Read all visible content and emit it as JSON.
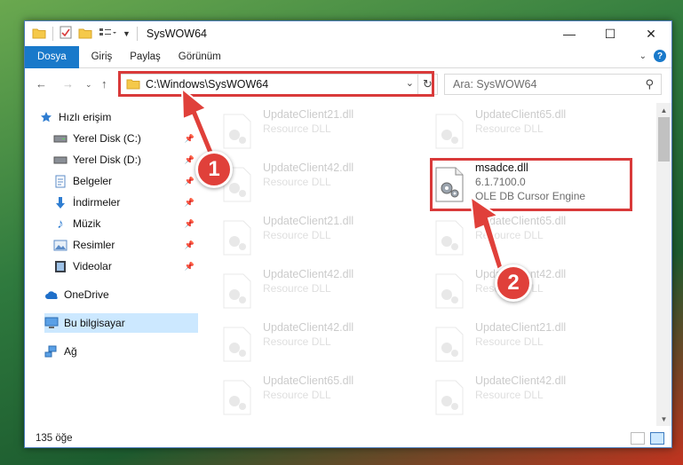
{
  "window": {
    "title": "SysWOW64",
    "controls": {
      "minimize": "—",
      "maximize": "☐",
      "close": "✕"
    }
  },
  "ribbon": {
    "tabs": [
      "Dosya",
      "Giriş",
      "Paylaş",
      "Görünüm"
    ],
    "help": "?"
  },
  "address": {
    "path": "C:\\Windows\\SysWOW64",
    "search_placeholder": "Ara: SysWOW64"
  },
  "nav": {
    "items": [
      {
        "label": "Hızlı erişim",
        "icon": "star-icon",
        "pinned": false
      },
      {
        "label": "Yerel Disk (C:)",
        "icon": "drive-icon",
        "pinned": true
      },
      {
        "label": "Yerel Disk (D:)",
        "icon": "drive-icon",
        "pinned": true
      },
      {
        "label": "Belgeler",
        "icon": "document-icon",
        "pinned": true
      },
      {
        "label": "İndirmeler",
        "icon": "download-icon",
        "pinned": true
      },
      {
        "label": "Müzik",
        "icon": "music-icon",
        "pinned": true
      },
      {
        "label": "Resimler",
        "icon": "pictures-icon",
        "pinned": true
      },
      {
        "label": "Videolar",
        "icon": "videos-icon",
        "pinned": true
      },
      {
        "label": "OneDrive",
        "icon": "cloud-icon",
        "pinned": false
      },
      {
        "label": "Bu bilgisayar",
        "icon": "computer-icon",
        "pinned": false
      },
      {
        "label": "Ağ",
        "icon": "network-icon",
        "pinned": false
      }
    ]
  },
  "files": [
    {
      "name": "UpdateClient21.dll",
      "sub1": "Resource DLL",
      "sub2": ""
    },
    {
      "name": "UpdateClient65.dll",
      "sub1": "Resource DLL",
      "sub2": ""
    },
    {
      "name": "UpdateClient42.dll",
      "sub1": "Resource DLL",
      "sub2": ""
    },
    {
      "name": "msadce.dll",
      "sub1": "6.1.7100.0",
      "sub2": "OLE DB Cursor Engine"
    },
    {
      "name": "UpdateClient21.dll",
      "sub1": "Resource DLL",
      "sub2": ""
    },
    {
      "name": "UpdateClient65.dll",
      "sub1": "Resource DLL",
      "sub2": ""
    },
    {
      "name": "UpdateClient42.dll",
      "sub1": "Resource DLL",
      "sub2": ""
    },
    {
      "name": "UpdateClient42.dll",
      "sub1": "Resource DLL",
      "sub2": ""
    },
    {
      "name": "UpdateClient42.dll",
      "sub1": "Resource DLL",
      "sub2": ""
    },
    {
      "name": "UpdateClient21.dll",
      "sub1": "Resource DLL",
      "sub2": ""
    },
    {
      "name": "UpdateClient65.dll",
      "sub1": "Resource DLL",
      "sub2": ""
    },
    {
      "name": "UpdateClient42.dll",
      "sub1": "Resource DLL",
      "sub2": ""
    }
  ],
  "status": {
    "count": "135 öğe"
  },
  "annotations": {
    "badge1": "1",
    "badge2": "2",
    "color": "#e0403a"
  }
}
